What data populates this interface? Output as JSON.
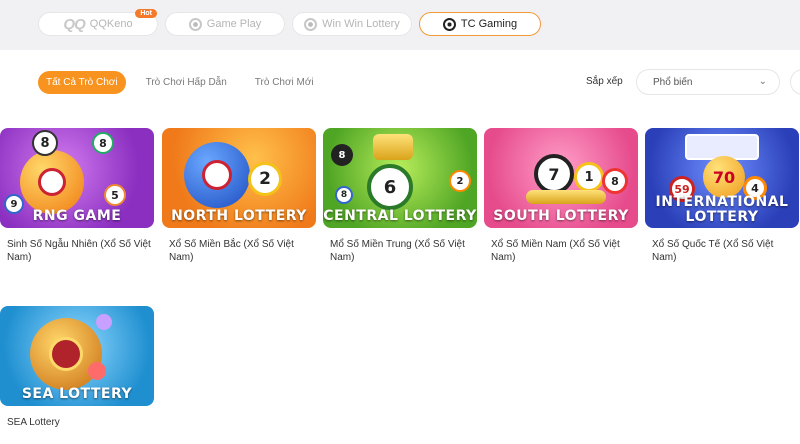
{
  "providers": [
    {
      "label": "QQKeno",
      "logo_text": "QQ",
      "badge": "Hot",
      "icon": "qq-logo-icon"
    },
    {
      "label": "Game Play",
      "icon": "game-play-icon"
    },
    {
      "label": "Win Win Lottery",
      "icon": "win-win-icon"
    },
    {
      "label": "TC Gaming",
      "icon": "tc-gaming-icon",
      "active": true
    }
  ],
  "tabs": [
    {
      "label": "Tất Cả Trò Chơi",
      "active": true
    },
    {
      "label": "Trò Chơi Hấp Dẫn"
    },
    {
      "label": "Trò Chơi Mới"
    }
  ],
  "sort": {
    "label": "Sắp xếp",
    "value": "Phổ biến",
    "chevron": "⌄"
  },
  "games": [
    {
      "banner": "RNG GAME",
      "title": "Sinh Số Ngẫu Nhiên (Xổ Số Việt Nam)",
      "bg": "#a048c8",
      "balls": [
        "8",
        "8",
        "5",
        "9"
      ]
    },
    {
      "banner": "NORTH LOTTERY",
      "title": "Xổ Số Miền Bắc (Xổ Số Việt Nam)",
      "bg": "#f08a22",
      "balls": [
        "2"
      ]
    },
    {
      "banner": "CENTRAL LOTTERY",
      "title": "Mổ Số Miền Trung (Xổ Số Việt Nam)",
      "bg": "#7cc43a",
      "balls": [
        "8",
        "6",
        "2",
        "8"
      ]
    },
    {
      "banner": "SOUTH LOTTERY",
      "title": "Xổ Số Miền Nam (Xổ Số Việt Nam)",
      "bg": "#f05c9a",
      "balls": [
        "7",
        "1",
        "8"
      ]
    },
    {
      "banner_line1": "INTERNATIONAL",
      "banner_line2": "LOTTERY",
      "title": "Xổ Số Quốc Tế (Xổ Số Việt Nam)",
      "bg": "#3a5fd6",
      "balls": [
        "59",
        "70",
        "4"
      ]
    },
    {
      "banner": "SEA LOTTERY",
      "title": "SEA Lottery",
      "bg": "#2aa0e0",
      "balls": []
    }
  ]
}
